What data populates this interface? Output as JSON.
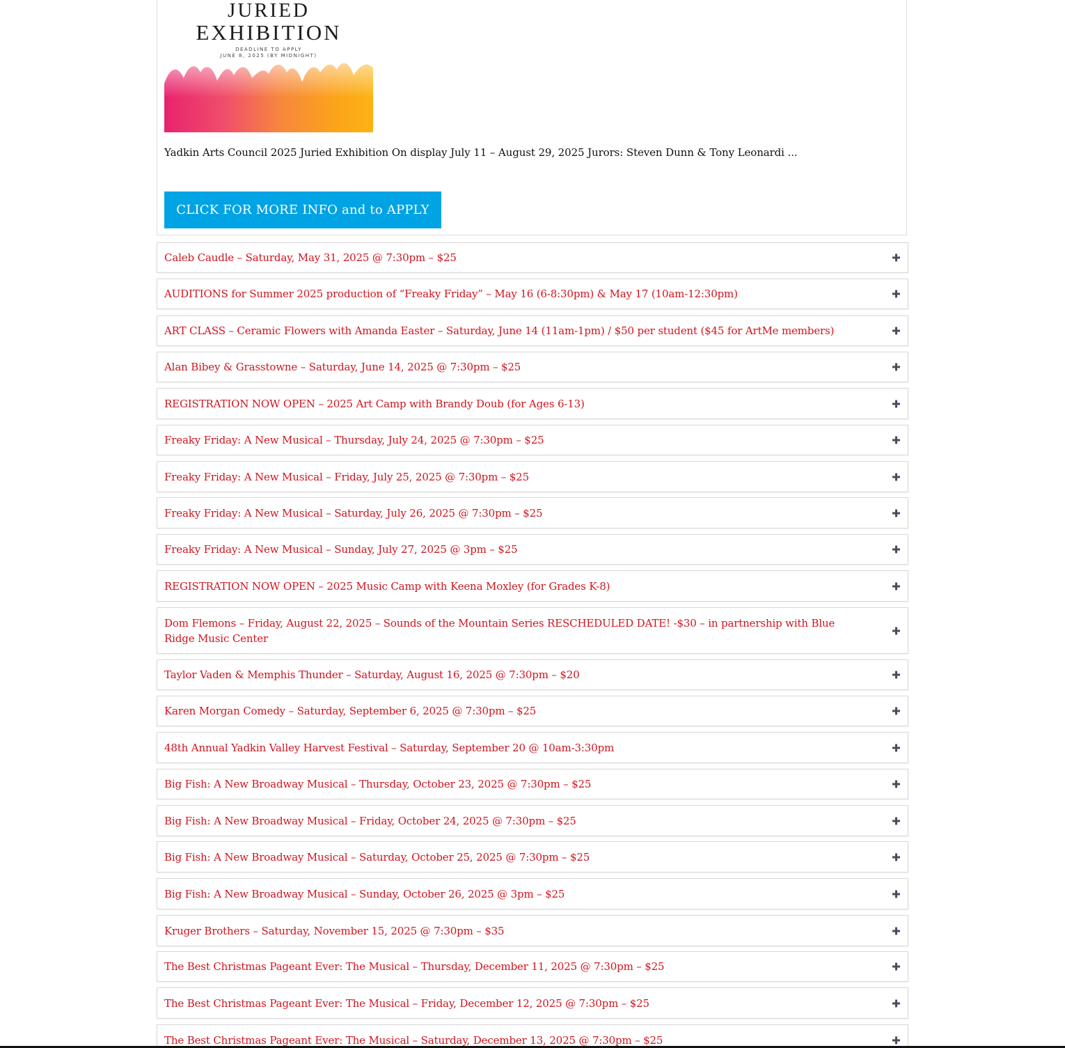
{
  "featured": {
    "poster_heading_line1": "JURIED",
    "poster_heading_line2": "EXHIBITION",
    "poster_deadline_line1": "DEADLINE TO APPLY",
    "poster_deadline_line2": "JUNE 8, 2025 (BY MIDNIGHT)",
    "excerpt": "Yadkin Arts Council 2025 Juried Exhibition On display July 11 – August 29, 2025 Jurors: Steven Dunn & Tony Leonardi ...",
    "cta_label": "CLICK FOR MORE INFO and to APPLY",
    "cta_color": "#00a3e4"
  },
  "accordion": {
    "title_color": "#d0141e",
    "icon": "plus-icon",
    "items": [
      {
        "title": "Caleb Caudle – Saturday, May 31, 2025 @ 7:30pm – $25"
      },
      {
        "title": "AUDITIONS for Summer 2025 production of “Freaky Friday” – May 16 (6-8:30pm) & May 17 (10am-12:30pm)"
      },
      {
        "title": "ART CLASS – Ceramic Flowers with Amanda Easter – Saturday, June 14 (11am-1pm) / $50 per student ($45 for ArtMe members)"
      },
      {
        "title": "Alan Bibey & Grasstowne – Saturday, June 14, 2025 @ 7:30pm – $25"
      },
      {
        "title": "REGISTRATION NOW OPEN – 2025 Art Camp with Brandy Doub (for Ages 6-13)"
      },
      {
        "title": "Freaky Friday: A New Musical – Thursday, July 24, 2025 @ 7:30pm – $25"
      },
      {
        "title": "Freaky Friday: A New Musical – Friday, July 25, 2025 @ 7:30pm – $25"
      },
      {
        "title": "Freaky Friday: A New Musical – Saturday, July 26, 2025 @ 7:30pm – $25"
      },
      {
        "title": "Freaky Friday: A New Musical – Sunday, July 27, 2025 @ 3pm – $25"
      },
      {
        "title": "REGISTRATION NOW OPEN – 2025 Music Camp with Keena Moxley (for Grades K-8)"
      },
      {
        "title": "Dom Flemons – Friday, August 22, 2025 – Sounds of the Mountain Series RESCHEDULED DATE! -$30 – in partnership with Blue Ridge Music Center"
      },
      {
        "title": "Taylor Vaden & Memphis Thunder – Saturday, August 16, 2025 @ 7:30pm – $20"
      },
      {
        "title": "Karen Morgan Comedy – Saturday, September 6, 2025 @ 7:30pm – $25"
      },
      {
        "title": "48th Annual Yadkin Valley Harvest Festival – Saturday, September 20 @ 10am-3:30pm"
      },
      {
        "title": "Big Fish: A New Broadway Musical – Thursday, October 23, 2025 @ 7:30pm – $25"
      },
      {
        "title": "Big Fish: A New Broadway Musical – Friday, October 24, 2025 @ 7:30pm – $25"
      },
      {
        "title": "Big Fish: A New Broadway Musical – Saturday, October 25, 2025 @ 7:30pm – $25"
      },
      {
        "title": "Big Fish: A New Broadway Musical – Sunday, October 26, 2025 @ 3pm – $25"
      },
      {
        "title": "Kruger Brothers – Saturday, November 15, 2025 @ 7:30pm – $35"
      },
      {
        "title": "The Best Christmas Pageant Ever: The Musical – Thursday, December 11, 2025 @ 7:30pm – $25"
      },
      {
        "title": "The Best Christmas Pageant Ever: The Musical – Friday, December 12, 2025 @ 7:30pm – $25"
      },
      {
        "title": "The Best Christmas Pageant Ever: The Musical – Saturday, December 13, 2025 @ 7:30pm – $25"
      }
    ]
  }
}
